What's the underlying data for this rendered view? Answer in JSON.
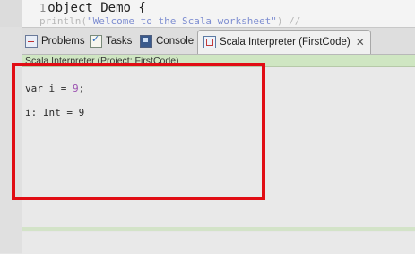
{
  "editor": {
    "line1_number": "1",
    "line1_keyword": "object",
    "line1_rest": " Demo {",
    "line2_prefix": "  println(",
    "line2_string": "\"Welcome to the Scala worksheet\"",
    "line2_suffix": ")        // "
  },
  "tabs": [
    {
      "label": "Problems",
      "icon": "problems-icon"
    },
    {
      "label": "Tasks",
      "icon": "tasks-icon"
    },
    {
      "label": "Console",
      "icon": "console-icon"
    },
    {
      "label": "Scala Interpreter (FirstCode)",
      "icon": "scala-icon",
      "active": true,
      "close": "✕"
    }
  ],
  "view_header": "Scala Interpreter (Project: FirstCode)",
  "output": {
    "line1_prefix": "var i = ",
    "line1_value": "9",
    "line1_suffix": ";",
    "line2": "i: Int = 9"
  },
  "colors": {
    "highlight": "#e10d14",
    "header_bg": "#cfe6c2"
  }
}
